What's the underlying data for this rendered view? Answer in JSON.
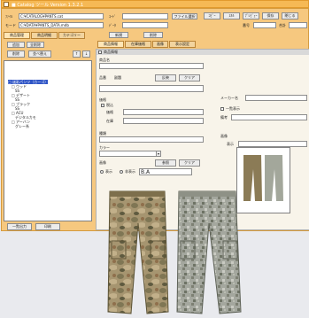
{
  "window": {
    "title": "■ Catalog ツール Version 1.3.2.1"
  },
  "toolbar": {
    "file_label": "ﾌｧｲﾙ",
    "file_value": "C:¥CATALOG¥PANTS.cat",
    "choose_button": "ファイル選択",
    "right_buttons": [
      "ｺﾋﾟｰ",
      "ｽｷﾙ",
      "ﾌﾟﾚﾋﾞｭｰ",
      "保存",
      "閉じる"
    ],
    "code_label": "ｺｰﾄﾞ",
    "code_value": "",
    "mode_label": "モード",
    "mode_value": "",
    "file2_label": "ﾃﾞｰﾀ",
    "file2_value": "C:¥DATA¥PANTS_DATA.mdb",
    "id_label": "番号",
    "id_value": "",
    "count_label": "合計",
    "count_value": "",
    "section_labels": [
      "商品管理",
      "商品明細",
      "カテゴリー"
    ],
    "section_buttons": [
      "新規",
      "削除"
    ]
  },
  "left": {
    "buttons_row1": [
      "追加",
      "全削除"
    ],
    "buttons_row2": [
      "削除",
      "並べ替え"
    ],
    "nav_up": "↑",
    "nav_down": "↓",
    "tree": [
      {
        "text": "□ 迷彩パンツ（カーゴ）",
        "selected": true
      },
      {
        "text": "　□ ウッド",
        "selected": false
      },
      {
        "text": "　　SS",
        "selected": false
      },
      {
        "text": "　□ デザート",
        "selected": false
      },
      {
        "text": "　　SS",
        "selected": false
      },
      {
        "text": "　□ ブラック",
        "selected": false
      },
      {
        "text": "　　SS",
        "selected": false
      },
      {
        "text": "　□ ACU",
        "selected": false
      },
      {
        "text": "　　デジタルカモ",
        "selected": false
      },
      {
        "text": "　□ アーバン",
        "selected": false
      },
      {
        "text": "　　グレー系",
        "selected": false
      }
    ],
    "footer_buttons": [
      "一覧出力",
      "印刷"
    ]
  },
  "tabs": [
    "商品情報",
    "在庫価格",
    "画像",
    "表示設定"
  ],
  "form": {
    "header": "商品情報",
    "name_label": "商品名",
    "name_value": "",
    "code_label": "品番",
    "code_value": "",
    "subtitle_label": "副題",
    "apply_button": "反映",
    "clear_button": "クリア",
    "desc_label": "説明文",
    "desc_value": "",
    "price_group_label": "価格",
    "price_check_label": "税込",
    "price_label": "価格",
    "price_value": "",
    "stock_label": "在庫",
    "stock_value": "",
    "type_label": "種類",
    "type_value": "",
    "color_label": "カラー",
    "color_value": "",
    "image_label": "画像",
    "image_buttons": [
      "参照",
      "クリア"
    ],
    "radio_labels": [
      "表示",
      "非表示"
    ],
    "img_name_value": "B.A",
    "right_name_label": "メーカー名",
    "right_name_value": "",
    "right_check_label": "一覧表示",
    "right_note_label": "備考",
    "right_note_value": "",
    "size_label": "サイズ",
    "size_value": "",
    "preview_label": "画像",
    "preview_caption": "表示"
  },
  "colors": {
    "title_bar": "#f6b955",
    "window_bg": "#f6c87f",
    "selection": "#2f55c6",
    "camo_multicam": "#9c8b63",
    "camo_acu": "#9ea39a"
  },
  "icons": [
    "app-icon",
    "pants-icon"
  ]
}
